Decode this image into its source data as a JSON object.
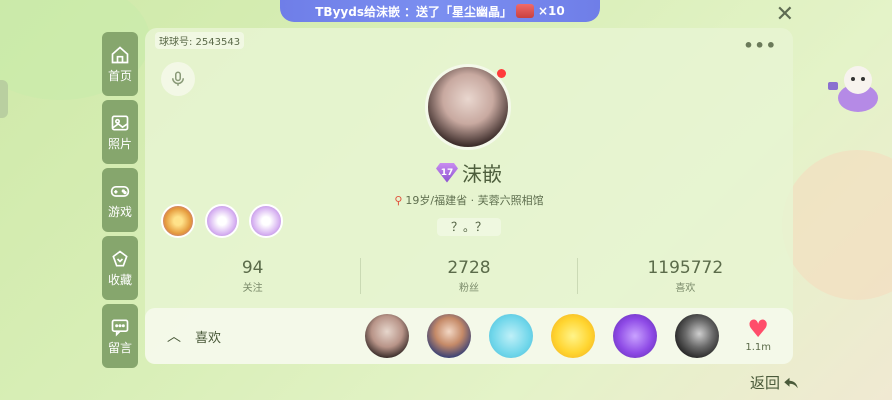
{
  "banner": {
    "text_before": "TByyds给沫嵌",
    "text_gift": "：送了「星尘幽晶」",
    "multiplier": "×10"
  },
  "sidebar": {
    "items": [
      {
        "label": "首页",
        "icon": "home-icon"
      },
      {
        "label": "照片",
        "icon": "photo-icon"
      },
      {
        "label": "游戏",
        "icon": "gamepad-icon"
      },
      {
        "label": "收藏",
        "icon": "collection-icon"
      },
      {
        "label": "留言",
        "icon": "message-icon"
      }
    ]
  },
  "profile": {
    "qiuqiu_id": "球球号: 2543543",
    "level": "17",
    "name": "沫嵌",
    "location": "19岁/福建省 · 芙蓉六照相馆",
    "signature": "？。？"
  },
  "stats": [
    {
      "value": "94",
      "label": "关注"
    },
    {
      "value": "2728",
      "label": "粉丝"
    },
    {
      "value": "1195772",
      "label": "喜欢"
    }
  ],
  "likes": {
    "label": "喜欢",
    "count": "1.1m"
  },
  "footer": {
    "back_label": "返回"
  },
  "colors": {
    "accent": "#86a66d",
    "heart": "#ff4d6a",
    "banner": "#7b8ff0"
  }
}
